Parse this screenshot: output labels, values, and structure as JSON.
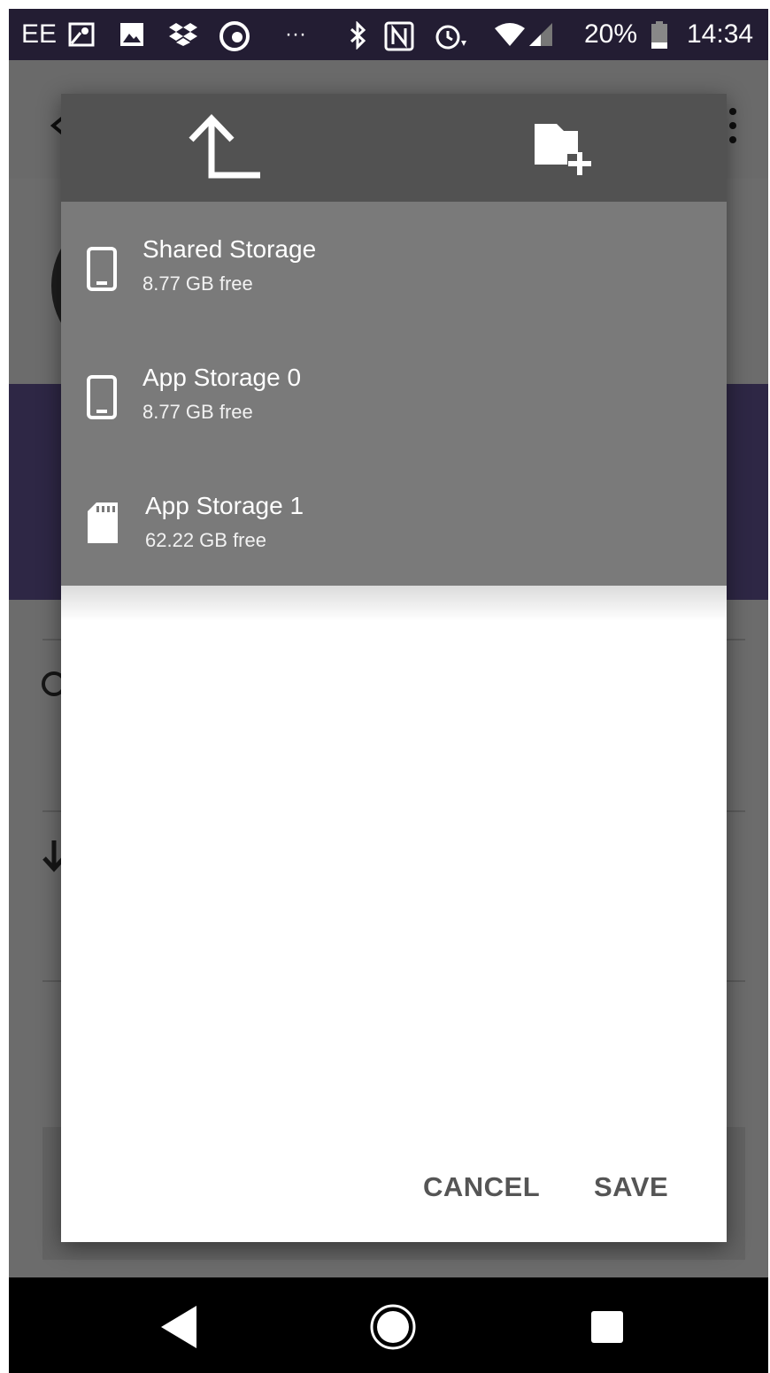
{
  "status_bar": {
    "carrier": "EE",
    "overflow": "···",
    "battery": "20%",
    "time": "14:34",
    "icons": [
      "maps-icon",
      "image-icon",
      "dropbox-icon",
      "edge-icon",
      "bluetooth-icon",
      "nfc-icon",
      "alarm-icon",
      "wifi-icon",
      "signal-icon",
      "battery-icon"
    ]
  },
  "dialog": {
    "toolbar": {
      "icons": [
        "up-arrow-icon",
        "new-folder-icon"
      ]
    },
    "storage_items": [
      {
        "name": "Shared Storage",
        "free": "8.77 GB free",
        "icon": "phone-icon"
      },
      {
        "name": "App Storage 0",
        "free": "8.77 GB free",
        "icon": "phone-icon"
      },
      {
        "name": "App Storage 1",
        "free": "62.22 GB free",
        "icon": "sd-card-icon"
      }
    ],
    "cancel_label": "CANCEL",
    "save_label": "SAVE"
  },
  "navigation_bar": {
    "icons": [
      "back-icon",
      "home-icon",
      "recents-icon"
    ]
  },
  "colors": {
    "status_bar": "#231d33",
    "dialog_toolbar": "#525252",
    "storage_list": "#7a7a7a",
    "app_accent": "#6a5a9e",
    "button_text": "#555555"
  }
}
